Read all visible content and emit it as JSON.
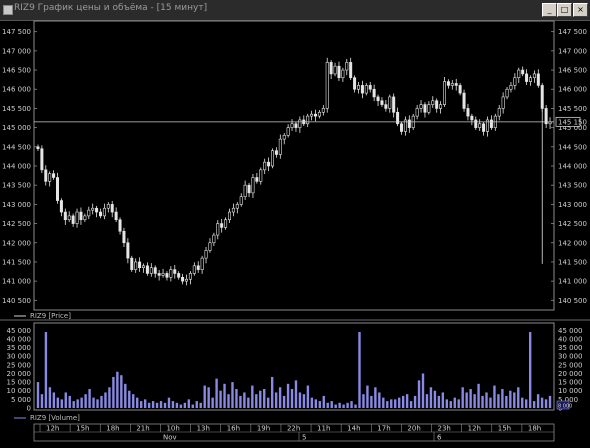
{
  "window": {
    "title": "RIZ9 График цены и объёма - [15 минут]",
    "buttons": {
      "minimize": "_",
      "maximize": "□",
      "close": "×"
    }
  },
  "colors": {
    "background": "#000000",
    "price": "#e6e6e6",
    "volume": "#8a8ae6",
    "price_line": "#cfcfcf"
  },
  "price_panel": {
    "legend": "RIZ9 [Price]",
    "current_price_label": "145 150"
  },
  "volume_panel": {
    "legend": "RIZ9 [Volume]",
    "current_volume_label": "8 000"
  },
  "chart_data": [
    {
      "type": "candlestick",
      "series": [
        {
          "name": "RIZ9 [Price]"
        }
      ],
      "ylim": [
        140300,
        147700
      ],
      "y_ticks": [
        "147 500",
        "147 000",
        "146 500",
        "146 000",
        "145 500",
        "145 000",
        "144 500",
        "144 000",
        "143 500",
        "143 000",
        "142 500",
        "142 000",
        "141 500",
        "141 000",
        "140 500"
      ],
      "last_price": 145150,
      "closes": [
        144450,
        143900,
        143600,
        143800,
        143700,
        143100,
        142800,
        142600,
        142700,
        142500,
        142800,
        142600,
        142700,
        142850,
        142900,
        142800,
        142700,
        142900,
        143000,
        142800,
        142600,
        142300,
        142000,
        141600,
        141300,
        141500,
        141350,
        141400,
        141200,
        141350,
        141200,
        141150,
        141200,
        141100,
        141300,
        141200,
        141100,
        141000,
        141050,
        141200,
        141400,
        141300,
        141600,
        141800,
        142000,
        142200,
        142500,
        142400,
        142600,
        142800,
        142900,
        143000,
        143200,
        143500,
        143300,
        143700,
        143600,
        143900,
        144100,
        144000,
        144400,
        144300,
        144700,
        144800,
        145000,
        145100,
        145000,
        145200,
        145100,
        145300,
        145350,
        145300,
        145400,
        145500,
        146700,
        146400,
        146600,
        146300,
        146500,
        146700,
        146300,
        146000,
        146100,
        145900,
        146100,
        146000,
        145800,
        145700,
        145600,
        145500,
        145800,
        145400,
        145100,
        144900,
        145200,
        145000,
        145300,
        145500,
        145600,
        145400,
        145600,
        145700,
        145500,
        145600,
        146200,
        146100,
        146150,
        146100,
        145900,
        145500,
        145300,
        145200,
        145000,
        145100,
        144900,
        145200,
        145000,
        145300,
        145500,
        145800,
        146000,
        146100,
        146300,
        146500,
        146400,
        146200,
        146300,
        146400,
        146100,
        145500,
        145100,
        145150
      ]
    },
    {
      "type": "bar",
      "series": [
        {
          "name": "RIZ9 [Volume]"
        }
      ],
      "ylim": [
        0,
        47500
      ],
      "y_ticks": [
        "45 000",
        "40 000",
        "35 000",
        "30 000",
        "25 000",
        "20 000",
        "15 000",
        "10 000",
        "5 000",
        "0"
      ],
      "values": [
        15000,
        8000,
        44000,
        12000,
        9000,
        6000,
        5000,
        9000,
        7000,
        4000,
        5000,
        6000,
        8000,
        11000,
        6000,
        5000,
        7000,
        9000,
        12000,
        18000,
        21000,
        19000,
        14000,
        10000,
        8000,
        6000,
        4000,
        5000,
        3000,
        4000,
        3000,
        4000,
        3000,
        6000,
        4000,
        3000,
        2000,
        3000,
        5000,
        2000,
        4000,
        3000,
        13000,
        12000,
        6000,
        17000,
        10000,
        14000,
        8000,
        15000,
        11000,
        7000,
        9000,
        6000,
        13000,
        8000,
        10000,
        11000,
        6000,
        18000,
        9000,
        12000,
        7000,
        14000,
        11000,
        16000,
        9000,
        8000,
        13000,
        6000,
        5000,
        4000,
        7000,
        3000,
        4000,
        2000,
        3000,
        2000,
        3000,
        4000,
        2000,
        44000,
        8000,
        13000,
        7000,
        12000,
        9000,
        6000,
        4000,
        5000,
        5000,
        6000,
        7000,
        8000,
        4000,
        7000,
        16000,
        20000,
        8000,
        12000,
        10000,
        7000,
        9000,
        5000,
        4000,
        6000,
        5000,
        12000,
        9000,
        11000,
        8000,
        14000,
        7000,
        9000,
        6000,
        13000,
        8000,
        11000,
        7000,
        10000,
        9000,
        12000,
        6000,
        5000,
        44000,
        4000,
        8000,
        6000,
        5000,
        7000
      ]
    }
  ],
  "time_axis": {
    "hours": [
      "12h",
      "15h",
      "18h",
      "21h",
      "10h",
      "13h",
      "16h",
      "19h",
      "22h",
      "11h",
      "14h",
      "17h",
      "20h",
      "23h",
      "12h",
      "15h",
      "18h"
    ],
    "dates": [
      "Nov",
      "5",
      "6"
    ]
  }
}
